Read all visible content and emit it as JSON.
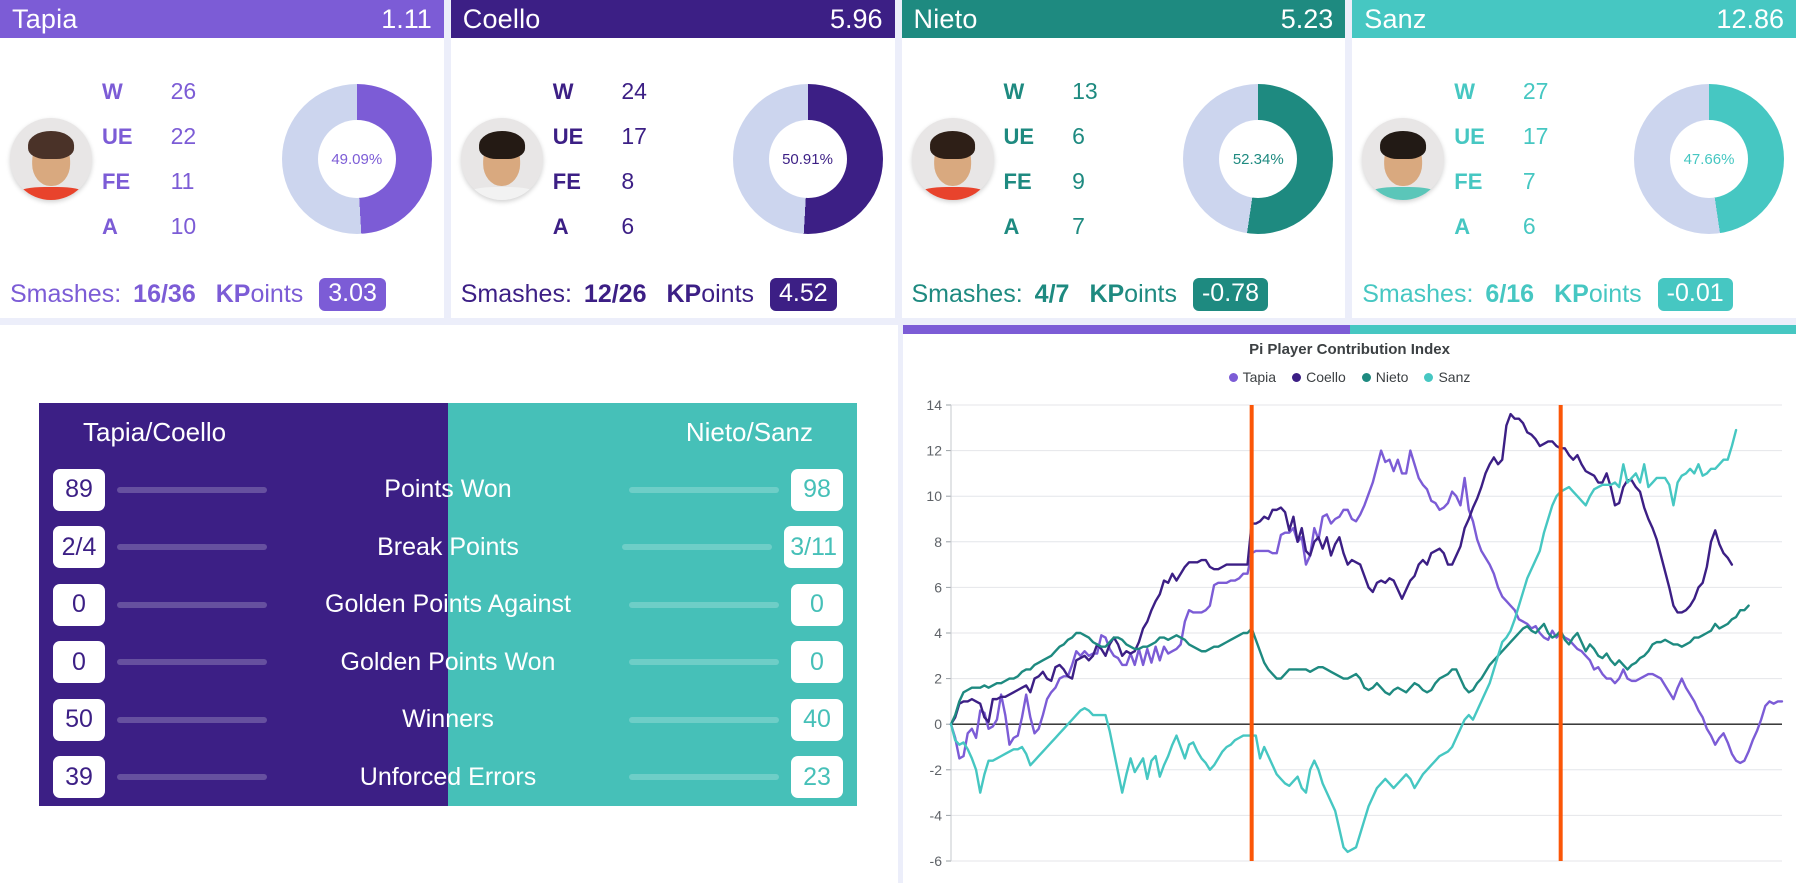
{
  "colors": {
    "tapia": "#7c5cd6",
    "coello": "#3c1f85",
    "nieto": "#1e8a80",
    "sanz": "#46c7c2",
    "donut_track": "#ccd5ee",
    "page_bg": "#eceefa",
    "panel_bg": "#ffffff",
    "marker": "#fb5607",
    "cmp_left": "#3c1f85",
    "cmp_right": "#46c0b8"
  },
  "players": [
    {
      "name": "Tapia",
      "score": "1.11",
      "avatar": "player-photo-tapia",
      "stats": [
        {
          "label": "W",
          "value": "26"
        },
        {
          "label": "UE",
          "value": "22"
        },
        {
          "label": "FE",
          "value": "11"
        },
        {
          "label": "A",
          "value": "10"
        }
      ],
      "donut_pct_label": "49.09%",
      "donut_pct": 49.09,
      "smashes_label": "Smashes:",
      "smashes_value": "16/36",
      "kpoints_label": "KPoints",
      "kpoints_value": "3.03",
      "color_key": "tapia",
      "hair": "#4a3228",
      "shirt": "#e8432c"
    },
    {
      "name": "Coello",
      "score": "5.96",
      "avatar": "player-photo-coello",
      "stats": [
        {
          "label": "W",
          "value": "24"
        },
        {
          "label": "UE",
          "value": "17"
        },
        {
          "label": "FE",
          "value": "8"
        },
        {
          "label": "A",
          "value": "6"
        }
      ],
      "donut_pct_label": "50.91%",
      "donut_pct": 50.91,
      "smashes_label": "Smashes:",
      "smashes_value": "12/26",
      "kpoints_label": "KPoints",
      "kpoints_value": "4.52",
      "color_key": "coello",
      "hair": "#241a14",
      "shirt": "#f2f2f2"
    },
    {
      "name": "Nieto",
      "score": "5.23",
      "avatar": "player-photo-nieto",
      "stats": [
        {
          "label": "W",
          "value": "13"
        },
        {
          "label": "UE",
          "value": "6"
        },
        {
          "label": "FE",
          "value": "9"
        },
        {
          "label": "A",
          "value": "7"
        }
      ],
      "donut_pct_label": "52.34%",
      "donut_pct": 52.34,
      "smashes_label": "Smashes:",
      "smashes_value": "4/7",
      "kpoints_label": "KPoints",
      "kpoints_value": "-0.78",
      "color_key": "nieto",
      "hair": "#2e1f17",
      "shirt": "#e8432c"
    },
    {
      "name": "Sanz",
      "score": "12.86",
      "avatar": "player-photo-sanz",
      "stats": [
        {
          "label": "W",
          "value": "27"
        },
        {
          "label": "UE",
          "value": "17"
        },
        {
          "label": "FE",
          "value": "7"
        },
        {
          "label": "A",
          "value": "6"
        }
      ],
      "donut_pct_label": "47.66%",
      "donut_pct": 47.66,
      "smashes_label": "Smashes:",
      "smashes_value": "6/16",
      "kpoints_label": "KPoints",
      "kpoints_value": "-0.01",
      "color_key": "sanz",
      "hair": "#221a15",
      "shirt": "#5bc6b9"
    }
  ],
  "comparison": {
    "team_left": "Tapia/Coello",
    "team_right": "Nieto/Sanz",
    "rows": [
      {
        "metric": "Points Won",
        "left": "89",
        "right": "98",
        "left_frac": 0.48,
        "right_frac": 0.52
      },
      {
        "metric": "Break Points",
        "left": "2/4",
        "right": "3/11",
        "left_frac": 0.5,
        "right_frac": 0.5
      },
      {
        "metric": "Golden Points Against",
        "left": "0",
        "right": "0",
        "left_frac": 0.5,
        "right_frac": 0.5
      },
      {
        "metric": "Golden Points Won",
        "left": "0",
        "right": "0",
        "left_frac": 0.5,
        "right_frac": 0.5
      },
      {
        "metric": "Winners",
        "left": "50",
        "right": "40",
        "left_frac": 0.56,
        "right_frac": 0.44
      },
      {
        "metric": "Unforced Errors",
        "left": "39",
        "right": "23",
        "left_frac": 0.63,
        "right_frac": 0.37
      }
    ]
  },
  "chart_data": {
    "type": "line",
    "title": "Pi Player Contribution Index",
    "xlabel": "",
    "ylabel": "",
    "ylim": [
      -6,
      14
    ],
    "yticks": [
      -6,
      -4,
      -2,
      0,
      2,
      4,
      6,
      8,
      10,
      12,
      14
    ],
    "grid": true,
    "legend_position": "top",
    "zero_line": 0,
    "annotations": [
      {
        "type": "vline",
        "x": 72,
        "color": "#fb5607",
        "label": "set-break-1"
      },
      {
        "type": "vline",
        "x": 146,
        "color": "#fb5607",
        "label": "set-break-2"
      }
    ],
    "series": [
      {
        "name": "Tapia",
        "color": "#7c5cd6",
        "values": [
          0,
          -0.6,
          -1.5,
          -1.4,
          -0.4,
          -0.2,
          -0.6,
          0.6,
          0.5,
          -0.2,
          -0.1,
          0.2,
          1.3,
          0.4,
          -0.9,
          -0.6,
          -0.5,
          0.3,
          1.3,
          0.3,
          -0.4,
          -0.2,
          0.4,
          1.1,
          1.4,
          1.6,
          2.0,
          2.1,
          2.1,
          2.6,
          3.2,
          3.0,
          3.2,
          3.0,
          3.1,
          3.1,
          3.9,
          3.8,
          3.3,
          3.0,
          2.9,
          2.6,
          2.6,
          3.1,
          2.6,
          3.3,
          2.6,
          3.3,
          2.7,
          3.4,
          2.8,
          3.4,
          3.1,
          3.2,
          3.3,
          3.5,
          4.5,
          5.0,
          4.9,
          4.9,
          4.9,
          5.0,
          5.2,
          6.1,
          6.2,
          6.2,
          6.2,
          6.3,
          6.3,
          6.4,
          6.6,
          6.6,
          7.5,
          7.6,
          7.6,
          7.6,
          7.6,
          7.5,
          7.5,
          8.3,
          8.4,
          8.4,
          8.6,
          8.0,
          8.2,
          7.0,
          7.4,
          8.6,
          8.1,
          9.1,
          9.2,
          8.8,
          9.0,
          9.1,
          9.4,
          9.4,
          9.0,
          8.9,
          9.2,
          9.6,
          10.1,
          10.6,
          11.3,
          12.0,
          11.5,
          11.6,
          11.1,
          11.6,
          11.0,
          11.0,
          12.0,
          11.4,
          10.8,
          10.5,
          10.3,
          9.8,
          9.7,
          9.4,
          9.5,
          9.7,
          10.2,
          10.0,
          9.6,
          10.8,
          9.4,
          8.9,
          8.1,
          7.6,
          7.3,
          7.0,
          6.6,
          6.0,
          5.6,
          5.4,
          5.2,
          5.0,
          4.6,
          4.5,
          4.4,
          4.2,
          4.3,
          4.0,
          3.8,
          3.7,
          4.1,
          3.8,
          4.0,
          3.8,
          3.7,
          3.5,
          3.3,
          3.2,
          3.0,
          2.8,
          2.4,
          2.5,
          2.2,
          2.0,
          2.0,
          1.8,
          2.0,
          2.4,
          2.0,
          1.9,
          1.9,
          2.0,
          2.1,
          2.2,
          2.2,
          2.1,
          2.0,
          1.7,
          1.4,
          1.1,
          1.6,
          2.0,
          1.6,
          1.3,
          1.0,
          0.6,
          0.3,
          -0.2,
          -0.5,
          -0.9,
          -0.6,
          -0.4,
          -0.8,
          -1.3,
          -1.6,
          -1.7,
          -1.6,
          -1.2,
          -0.7,
          -0.3,
          0.2,
          0.8,
          1.0,
          0.9,
          1.0,
          1.0
        ]
      },
      {
        "name": "Coello",
        "color": "#3c1f85",
        "values": [
          0,
          0.3,
          0.9,
          1.0,
          1.0,
          1.1,
          1.0,
          0.9,
          0.3,
          0.1,
          1.1,
          1.1,
          1.2,
          1.2,
          1.3,
          1.4,
          1.5,
          1.6,
          1.7,
          1.4,
          2.0,
          2.1,
          2.3,
          2.0,
          1.9,
          2.5,
          2.6,
          2.4,
          2.1,
          2.0,
          2.8,
          2.9,
          3.0,
          2.8,
          3.0,
          3.5,
          3.3,
          3.0,
          3.5,
          3.8,
          3.5,
          3.0,
          3.2,
          3.1,
          3.2,
          3.6,
          4.2,
          4.5,
          5.0,
          5.4,
          5.7,
          6.3,
          6.2,
          6.6,
          6.3,
          6.6,
          6.9,
          7.1,
          7.1,
          7.1,
          7.2,
          7.2,
          6.9,
          6.8,
          6.8,
          6.9,
          7.0,
          7.0,
          7.0,
          7.0,
          7.0,
          7.0,
          8.8,
          8.8,
          8.9,
          9.1,
          9.0,
          9.4,
          9.4,
          9.5,
          9.3,
          8.5,
          9.1,
          8.0,
          8.6,
          7.6,
          7.4,
          8.0,
          8.2,
          7.7,
          8.2,
          7.4,
          7.9,
          8.2,
          7.5,
          7.0,
          7.2,
          7.1,
          7.0,
          6.5,
          6.0,
          5.8,
          6.2,
          6.3,
          6.2,
          6.4,
          6.3,
          5.9,
          5.5,
          5.9,
          6.3,
          6.5,
          7.0,
          7.2,
          7.0,
          7.5,
          7.6,
          7.7,
          7.5,
          7.0,
          7.0,
          7.4,
          7.8,
          8.6,
          9.0,
          9.5,
          9.9,
          10.4,
          11.0,
          11.4,
          11.7,
          11.4,
          11.6,
          13.1,
          13.6,
          13.4,
          13.4,
          13.2,
          12.8,
          12.7,
          12.5,
          12.2,
          12.3,
          12.4,
          12.4,
          12.2,
          12.1,
          12.1,
          11.8,
          11.6,
          11.8,
          11.4,
          11.1,
          11.0,
          10.9,
          10.6,
          10.6,
          11.0,
          10.4,
          9.6,
          9.7,
          10.4,
          10.7,
          10.7,
          10.4,
          10.2,
          9.5,
          9.0,
          8.6,
          8.1,
          7.4,
          6.7,
          6.0,
          5.2,
          4.9,
          4.9,
          5.0,
          5.2,
          5.5,
          6.0,
          6.2,
          6.9,
          8.0,
          8.5,
          7.9,
          7.5,
          7.3,
          7.0
        ]
      },
      {
        "name": "Nieto",
        "color": "#1e8a80",
        "values": [
          0,
          0.4,
          1.0,
          1.4,
          1.5,
          1.6,
          1.6,
          1.6,
          1.7,
          1.6,
          1.7,
          1.8,
          1.8,
          1.9,
          2.0,
          2.0,
          2.1,
          2.3,
          2.4,
          2.4,
          2.6,
          2.7,
          2.8,
          2.9,
          3.0,
          3.2,
          3.4,
          3.5,
          3.7,
          3.8,
          4.0,
          4.0,
          3.9,
          3.8,
          3.6,
          3.5,
          3.4,
          3.4,
          3.6,
          3.8,
          3.8,
          3.7,
          3.5,
          3.4,
          3.3,
          3.3,
          3.4,
          3.4,
          3.5,
          3.6,
          3.8,
          3.8,
          3.7,
          3.8,
          3.9,
          3.8,
          3.7,
          3.5,
          3.4,
          3.3,
          3.2,
          3.2,
          3.3,
          3.4,
          3.4,
          3.5,
          3.6,
          3.7,
          3.8,
          3.9,
          4.0,
          4.0,
          4.2,
          3.7,
          3.2,
          2.7,
          2.4,
          2.2,
          2.0,
          2.0,
          2.2,
          2.4,
          2.4,
          2.4,
          2.4,
          2.4,
          2.3,
          2.4,
          2.5,
          2.5,
          2.4,
          2.3,
          2.2,
          2.1,
          2.0,
          2.0,
          2.1,
          2.2,
          2.0,
          1.6,
          1.5,
          1.6,
          1.8,
          1.6,
          1.4,
          1.3,
          1.5,
          1.6,
          1.5,
          1.4,
          1.6,
          1.8,
          1.7,
          1.5,
          1.4,
          1.5,
          1.8,
          2.0,
          2.1,
          2.2,
          2.4,
          2.4,
          2.0,
          1.6,
          1.4,
          1.5,
          1.8,
          2.0,
          2.3,
          2.6,
          2.8,
          3.0,
          3.2,
          3.4,
          3.6,
          3.8,
          4.0,
          4.2,
          4.3,
          4.1,
          4.0,
          4.2,
          4.4,
          4.0,
          3.8,
          3.9,
          4.1,
          3.7,
          3.5,
          3.8,
          4.0,
          3.6,
          3.2,
          3.5,
          3.3,
          3.0,
          2.9,
          3.1,
          2.8,
          2.6,
          2.8,
          2.6,
          2.4,
          2.6,
          2.7,
          2.9,
          3.0,
          3.2,
          3.5,
          3.6,
          3.6,
          3.7,
          3.6,
          3.5,
          3.5,
          3.4,
          3.5,
          3.6,
          3.8,
          3.8,
          3.9,
          4.0,
          4.1,
          4.4,
          4.2,
          4.3,
          4.4,
          4.6,
          4.7,
          5.0,
          5.0,
          5.2
        ]
      },
      {
        "name": "Sanz",
        "color": "#46c7c2",
        "values": [
          0,
          -0.7,
          -0.9,
          -0.8,
          -1.1,
          -1.5,
          -2.0,
          -3.0,
          -2.2,
          -1.6,
          -1.6,
          -1.5,
          -1.4,
          -1.3,
          -1.2,
          -1.1,
          -1.1,
          -1.0,
          -1.3,
          -1.8,
          -1.6,
          -1.4,
          -1.2,
          -1.0,
          -0.8,
          -0.6,
          -0.4,
          -0.2,
          0.0,
          0.2,
          0.4,
          0.6,
          0.7,
          0.6,
          0.4,
          0.4,
          0.4,
          0.4,
          -0.3,
          -1.2,
          -2.1,
          -3.0,
          -2.2,
          -1.5,
          -2.1,
          -1.8,
          -1.5,
          -2.4,
          -1.6,
          -1.4,
          -2.3,
          -1.8,
          -1.4,
          -0.9,
          -0.5,
          -1.0,
          -1.5,
          -0.9,
          -0.8,
          -1.2,
          -1.5,
          -1.7,
          -2.0,
          -1.8,
          -1.5,
          -1.2,
          -1.0,
          -0.9,
          -0.7,
          -0.6,
          -0.5,
          -0.5,
          -0.5,
          -0.5,
          -1.5,
          -1.0,
          -1.4,
          -1.8,
          -2.2,
          -2.4,
          -2.6,
          -2.7,
          -2.5,
          -2.3,
          -2.8,
          -3.0,
          -2.0,
          -1.6,
          -2.0,
          -2.6,
          -3.0,
          -3.4,
          -3.8,
          -4.6,
          -5.4,
          -5.6,
          -5.5,
          -5.4,
          -4.8,
          -4.2,
          -3.6,
          -3.2,
          -2.8,
          -2.6,
          -2.4,
          -2.6,
          -2.8,
          -2.6,
          -2.4,
          -2.2,
          -2.4,
          -2.8,
          -2.5,
          -2.2,
          -2.0,
          -1.8,
          -1.6,
          -1.4,
          -1.3,
          -1.2,
          -1.0,
          -0.6,
          -0.2,
          0.2,
          0.4,
          0.2,
          0.6,
          1.0,
          1.4,
          1.8,
          2.4,
          3.0,
          3.6,
          3.8,
          4.1,
          4.6,
          5.2,
          5.8,
          6.4,
          6.8,
          7.2,
          7.6,
          8.4,
          9.0,
          9.6,
          10.0,
          10.2,
          10.3,
          10.4,
          10.2,
          10.0,
          9.8,
          9.6,
          10.0,
          10.3,
          10.4,
          10.5,
          10.5,
          10.5,
          10.6,
          10.4,
          11.4,
          10.6,
          10.8,
          11.0,
          10.6,
          11.4,
          10.4,
          10.6,
          10.8,
          10.8,
          10.8,
          10.5,
          9.6,
          10.6,
          10.9,
          11.0,
          11.2,
          11.0,
          11.4,
          10.9,
          11.0,
          11.2,
          11.2,
          11.4,
          11.6,
          11.6,
          12.2,
          12.9
        ]
      }
    ]
  }
}
